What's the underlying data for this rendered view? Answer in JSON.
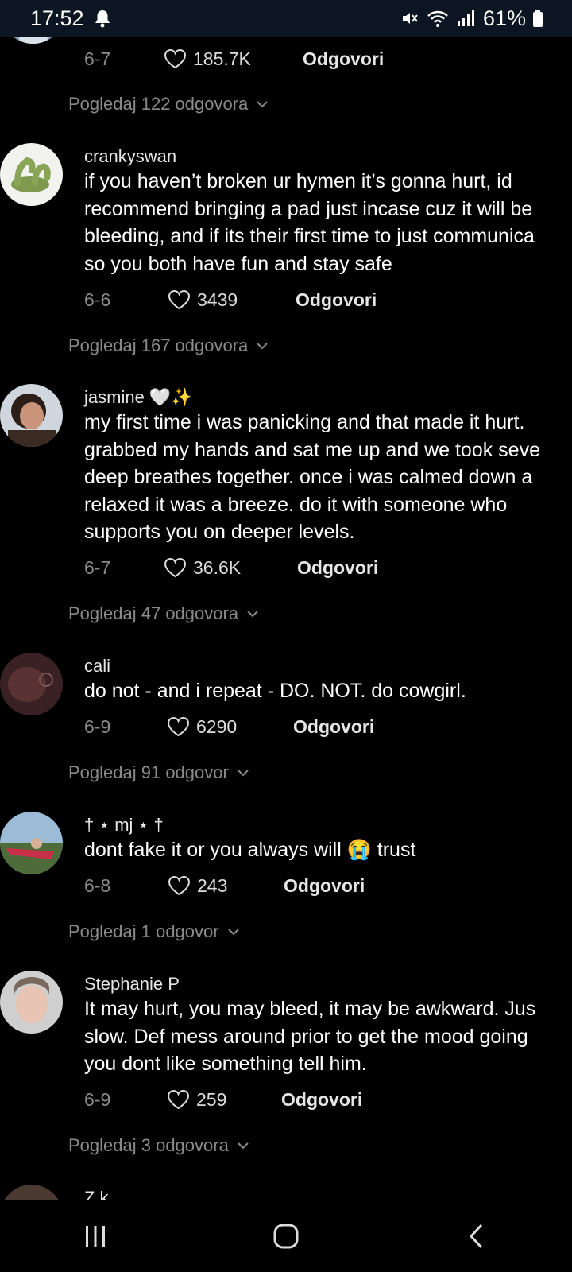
{
  "status_bar": {
    "time": "17:52",
    "battery": "61%",
    "icons": [
      "bell-icon",
      "mute-icon",
      "wifi-icon",
      "signal-icon",
      "battery-icon"
    ]
  },
  "top_partial": {
    "date": "6-7",
    "likes": "185.7K",
    "reply_label": "Odgovori",
    "view_replies": "Pogledaj 122 odgovora"
  },
  "comments": [
    {
      "username": "crankyswan",
      "lines": [
        "if you haven’t broken ur hymen it’s gonna hurt, id",
        "recommend bringing a pad just incase cuz it will be",
        "bleeding, and if its their first time to just communica",
        "so you both have fun and stay safe"
      ],
      "date": "6-6",
      "likes": "3439",
      "reply_label": "Odgovori",
      "view_replies": "Pogledaj 167 odgovora"
    },
    {
      "username": "jasmine 🤍✨",
      "lines": [
        "my first time i was panicking and that made it hurt.",
        "grabbed my hands and sat me up and we took seve",
        "deep breathes together. once i was calmed down a",
        "relaxed it was a breeze. do it with someone who",
        "supports you on deeper levels."
      ],
      "date": "6-7",
      "likes": "36.6K",
      "reply_label": "Odgovori",
      "view_replies": "Pogledaj 47 odgovora"
    },
    {
      "username": "cali",
      "lines": [
        "do not - and i repeat - DO. NOT. do cowgirl."
      ],
      "date": "6-9",
      "likes": "6290",
      "reply_label": "Odgovori",
      "view_replies": "Pogledaj 91 odgovor"
    },
    {
      "username": "† ⋆ mj ⋆ †",
      "lines": [
        "dont fake it or you always will 😭 trust"
      ],
      "date": "6-8",
      "likes": "243",
      "reply_label": "Odgovori",
      "view_replies": "Pogledaj 1 odgovor"
    },
    {
      "username": "Stephanie P",
      "lines": [
        "It may hurt, you may bleed, it may be awkward. Jus",
        "slow. Def mess around prior to get the mood going",
        "you dont like something tell him."
      ],
      "date": "6-9",
      "likes": "259",
      "reply_label": "Odgovori",
      "view_replies": "Pogledaj 3 odgovora"
    }
  ],
  "bottom_partial": {
    "username": "Z k"
  },
  "nav_bar": {
    "icons": [
      "recent-apps-icon",
      "home-icon",
      "back-icon"
    ]
  }
}
